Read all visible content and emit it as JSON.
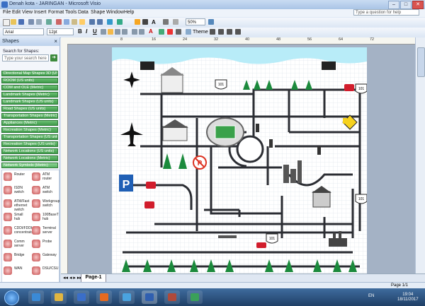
{
  "window": {
    "title": "Denah kota - JARINGAN - Microsoft Visio",
    "minimize": "–",
    "maximize": "□",
    "close": "✕"
  },
  "menubar": {
    "items": [
      "File",
      "Edit",
      "View",
      "Insert",
      "Format",
      "Tools",
      "Data",
      "Shape",
      "Window",
      "Help"
    ],
    "help_placeholder": "Type a question for help"
  },
  "toolbar": {
    "zoom": "50%",
    "theme_label": "Theme"
  },
  "formatting": {
    "font": "Arial",
    "size": "12pt",
    "bold": "B",
    "italic": "I",
    "underline": "U"
  },
  "shapes_panel": {
    "title": "Shapes",
    "search_label": "Search for Shapes:",
    "search_placeholder": "Type your search here",
    "stencils": [
      "Directional Map Shapes 3D (US u...",
      "ROOM (US units)",
      "COM and OLE (Metric)",
      "Landmark Shapes (Metric)",
      "Landmark Shapes (US units)",
      "Road Shapes (US units)",
      "Transportation Shapes (Metric)",
      "Appliances (Metric)",
      "Recreation Shapes (Metric)",
      "Transportation Shapes (US units)",
      "Recreation Shapes (US units)",
      "Network Locations (US units)",
      "Network Locations (Metric)",
      "Network Symbols (Metric)"
    ],
    "shapes": [
      "Router",
      "ATM router",
      "ISDN switch",
      "ATM switch",
      "ATM/Fast ethernet switch",
      "Workgroup switch",
      "Small hub",
      "100BaseT hub",
      "CDDI/FDDI concentrator",
      "Terminal server",
      "Comm server",
      "Probe",
      "Bridge",
      "Gateway",
      "WAN",
      "DSU/CSU"
    ]
  },
  "ruler": {
    "labels": [
      "8",
      "16",
      "24",
      "32",
      "40",
      "48",
      "56",
      "64",
      "72"
    ]
  },
  "map": {
    "road_sign_numbers": [
      "101",
      "101",
      "101",
      "101"
    ]
  },
  "page_tabs": {
    "page": "Page-1"
  },
  "status": {
    "page_indicator": "Page 1/1"
  },
  "taskbar": {
    "lang": "EN",
    "time": "19:04",
    "date": "18/11/2017"
  },
  "colors": {
    "road": "#2b2d33",
    "tree": "#1b8a3c",
    "sky": "#b8ecf8",
    "stencil": "#4caf50"
  }
}
